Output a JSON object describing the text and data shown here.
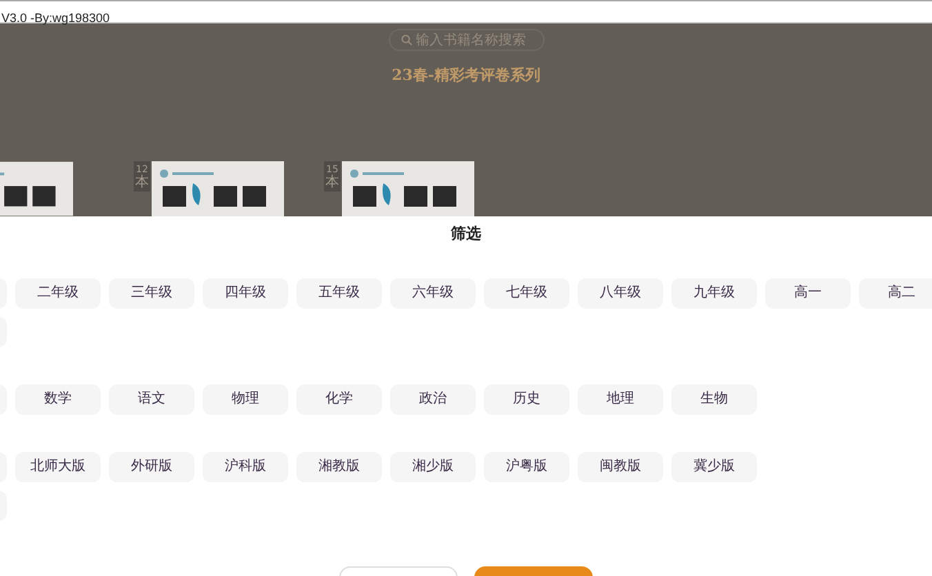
{
  "window": {
    "title": "V3.0 -By:wg198300"
  },
  "page": {
    "search": {
      "placeholder": "输入书籍名称搜索"
    },
    "heading": "23春-精彩考评卷系列",
    "books": [
      {
        "kind": "cut"
      },
      {
        "kind": "book",
        "count": "12",
        "unit": "本"
      },
      {
        "kind": "book",
        "count": "15",
        "unit": "本"
      }
    ]
  },
  "filter_sheet": {
    "title": "筛选",
    "groups": [
      {
        "lines": [
          [
            {
              "kind": "cut"
            },
            {
              "kind": "option",
              "label": "二年级"
            },
            {
              "kind": "option",
              "label": "三年级"
            },
            {
              "kind": "option",
              "label": "四年级"
            },
            {
              "kind": "option",
              "label": "五年级"
            },
            {
              "kind": "option",
              "label": "六年级"
            },
            {
              "kind": "option",
              "label": "七年级"
            },
            {
              "kind": "option",
              "label": "八年级"
            },
            {
              "kind": "option",
              "label": "九年级"
            },
            {
              "kind": "option",
              "label": "高一"
            },
            {
              "kind": "option",
              "label": "高二"
            }
          ],
          [
            {
              "kind": "cut"
            }
          ]
        ]
      },
      {
        "lines": [
          [
            {
              "kind": "cut"
            },
            {
              "kind": "option",
              "label": "数学"
            },
            {
              "kind": "option",
              "label": "语文"
            },
            {
              "kind": "option",
              "label": "物理"
            },
            {
              "kind": "option",
              "label": "化学"
            },
            {
              "kind": "option",
              "label": "政治"
            },
            {
              "kind": "option",
              "label": "历史"
            },
            {
              "kind": "option",
              "label": "地理"
            },
            {
              "kind": "option",
              "label": "生物"
            }
          ]
        ]
      },
      {
        "lines": [
          [
            {
              "kind": "cut"
            },
            {
              "kind": "option",
              "label": "北师大版"
            },
            {
              "kind": "option",
              "label": "外研版"
            },
            {
              "kind": "option",
              "label": "沪科版"
            },
            {
              "kind": "option",
              "label": "湘教版"
            },
            {
              "kind": "option",
              "label": "湘少版"
            },
            {
              "kind": "option",
              "label": "沪粤版"
            },
            {
              "kind": "option",
              "label": "闽教版"
            },
            {
              "kind": "option",
              "label": "冀少版"
            }
          ],
          [
            {
              "kind": "cut"
            }
          ]
        ]
      }
    ],
    "buttons": [
      {
        "kind": "outline"
      },
      {
        "kind": "primary"
      }
    ]
  }
}
